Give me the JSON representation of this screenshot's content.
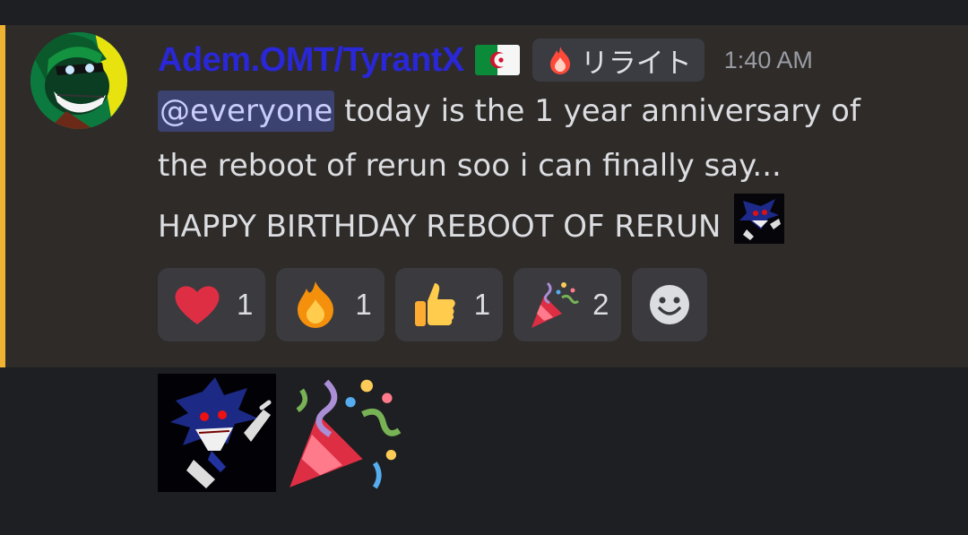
{
  "message": {
    "username": "Adem.OMT/TyrantX",
    "flag_icon": "algeria-flag-icon",
    "role_tag": {
      "icon": "fire-icon",
      "label": "リライト"
    },
    "timestamp": "1:40 AM",
    "mention": "@everyone",
    "text_line_1": " today is the 1 year anniversary of",
    "text_line_2": "the reboot of rerun soo i can finally say...",
    "text_line_3": "HAPPY BIRTHDAY REBOOT OF RERUN",
    "inline_emoji": "custom-sonic-exe-emoji",
    "reactions": [
      {
        "emoji": "heart-icon",
        "count": "1"
      },
      {
        "emoji": "fire-icon",
        "count": "1"
      },
      {
        "emoji": "thumbs-up-icon",
        "count": "1"
      },
      {
        "emoji": "party-popper-icon",
        "count": "2"
      }
    ],
    "add_reaction_icon": "smiley-add-reaction-icon"
  },
  "followup": {
    "emojis": [
      "custom-sonic-exe-emoji",
      "party-popper-icon"
    ]
  },
  "colors": {
    "background": "#1e1f22",
    "highlight_background": "#2e2b29",
    "mention_bar": "#f0b232",
    "username": "#2a27d6",
    "mention_bg": "#3c4270",
    "text": "#dcdde1"
  }
}
